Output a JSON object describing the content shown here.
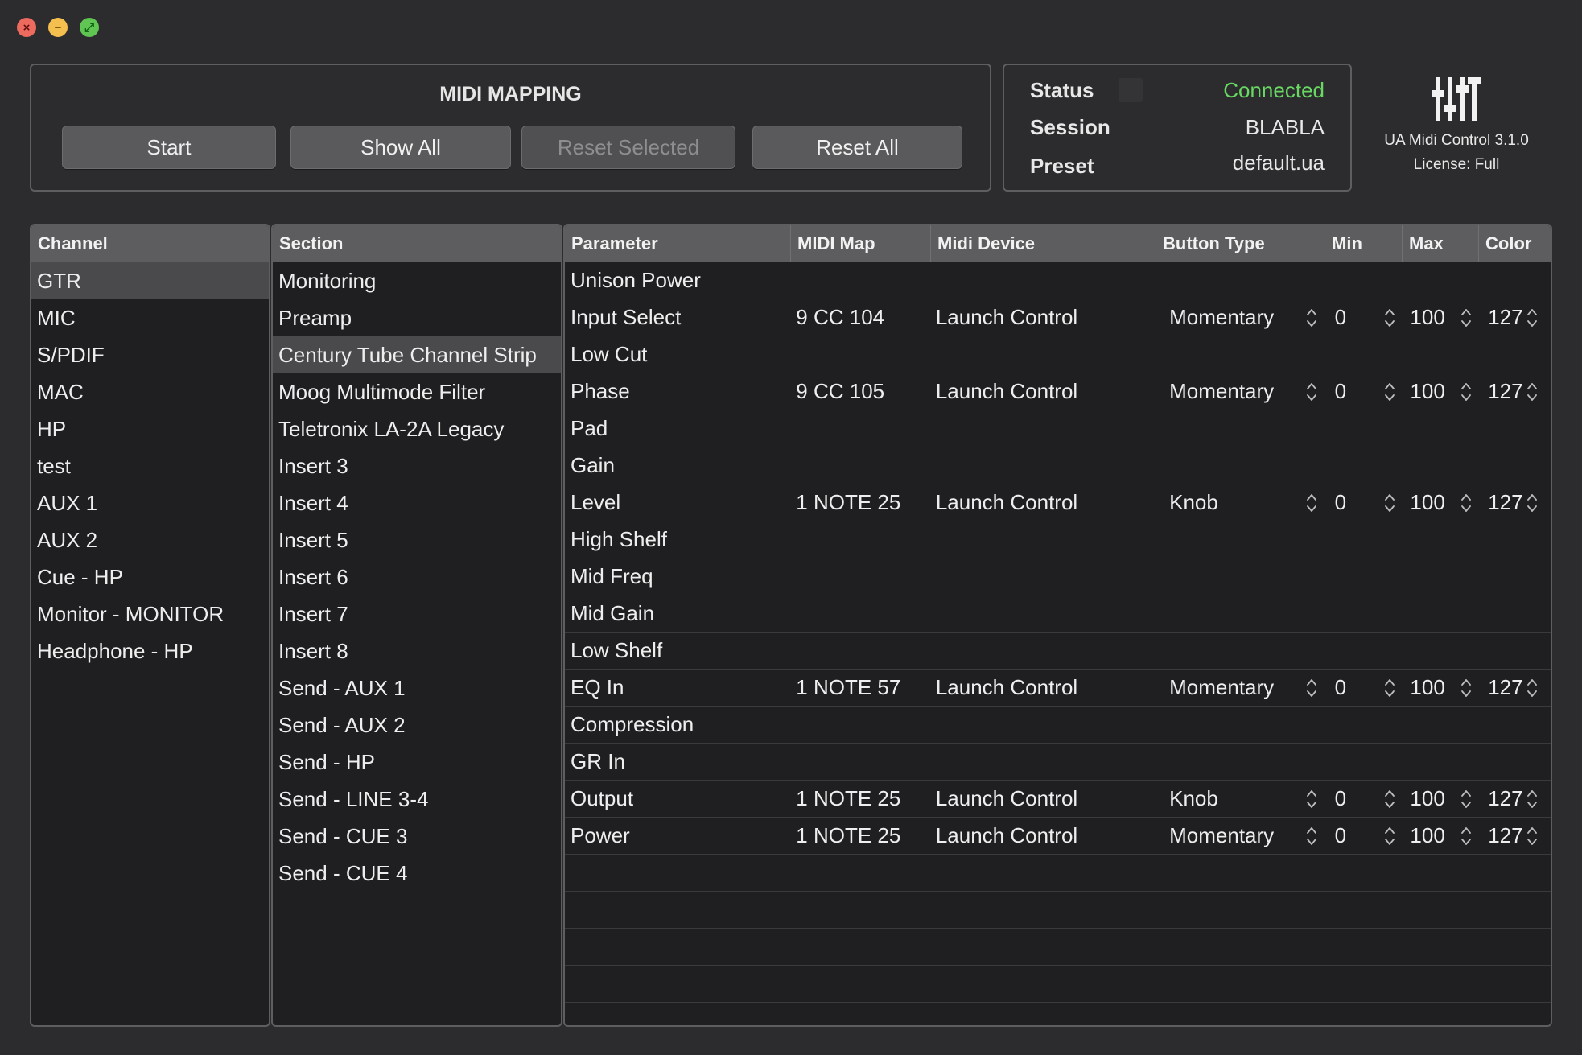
{
  "window": {
    "controls": [
      "close",
      "minimize",
      "zoom"
    ]
  },
  "mapping": {
    "title": "MIDI MAPPING",
    "buttons": {
      "start": "Start",
      "show_all": "Show All",
      "reset_selected": "Reset Selected",
      "reset_all": "Reset All"
    }
  },
  "status": {
    "status_label": "Status",
    "status_value": "Connected",
    "session_label": "Session",
    "session_value": "BLABLA",
    "preset_label": "Preset",
    "preset_value": "default.ua",
    "connected_color": "#68d862"
  },
  "app": {
    "name": "UA Midi Control 3.1.0",
    "license": "License: Full"
  },
  "channels": {
    "header": "Channel",
    "selected": "GTR",
    "items": [
      "GTR",
      "MIC",
      "S/PDIF",
      "MAC",
      "HP",
      "test",
      "AUX 1",
      "AUX 2",
      "Cue - HP",
      "Monitor - MONITOR",
      "Headphone - HP"
    ]
  },
  "sections": {
    "header": "Section",
    "selected": "Century Tube Channel Strip",
    "items": [
      "Monitoring",
      "Preamp",
      "Century Tube Channel Strip",
      "Moog Multimode Filter",
      "Teletronix LA-2A Legacy",
      "Insert 3",
      "Insert 4",
      "Insert 5",
      "Insert 6",
      "Insert 7",
      "Insert 8",
      "Send - AUX 1",
      "Send - AUX 2",
      "Send - HP",
      "Send - LINE 3-4",
      "Send - CUE 3",
      "Send - CUE 4"
    ]
  },
  "params": {
    "headers": {
      "parameter": "Parameter",
      "midi_map": "MIDI Map",
      "midi_device": "Midi Device",
      "button_type": "Button Type",
      "min": "Min",
      "max": "Max",
      "color": "Color"
    },
    "rows": [
      {
        "parameter": "Unison Power"
      },
      {
        "parameter": "Input Select",
        "midi_map": "9 CC 104",
        "device": "Launch Control",
        "button_type": "Momentary",
        "min": "0",
        "max": "100",
        "color": "127"
      },
      {
        "parameter": "Low Cut"
      },
      {
        "parameter": "Phase",
        "midi_map": "9 CC 105",
        "device": "Launch Control",
        "button_type": "Momentary",
        "min": "0",
        "max": "100",
        "color": "127"
      },
      {
        "parameter": "Pad"
      },
      {
        "parameter": "Gain"
      },
      {
        "parameter": "Level",
        "midi_map": "1 NOTE 25",
        "device": "Launch Control",
        "button_type": "Knob",
        "min": "0",
        "max": "100",
        "color": "127"
      },
      {
        "parameter": "High Shelf"
      },
      {
        "parameter": "Mid Freq"
      },
      {
        "parameter": "Mid Gain"
      },
      {
        "parameter": "Low Shelf"
      },
      {
        "parameter": "EQ In",
        "midi_map": "1 NOTE 57",
        "device": "Launch Control",
        "button_type": "Momentary",
        "min": "0",
        "max": "100",
        "color": "127"
      },
      {
        "parameter": "Compression"
      },
      {
        "parameter": "GR In"
      },
      {
        "parameter": "Output",
        "midi_map": "1 NOTE 25",
        "device": "Launch Control",
        "button_type": "Knob",
        "min": "0",
        "max": "100",
        "color": "127"
      },
      {
        "parameter": "Power",
        "midi_map": "1 NOTE 25",
        "device": "Launch Control",
        "button_type": "Momentary",
        "min": "0",
        "max": "100",
        "color": "127"
      }
    ]
  }
}
